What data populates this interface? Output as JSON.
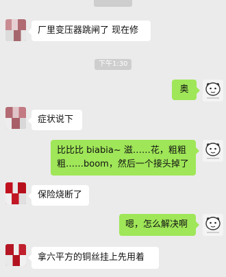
{
  "chat": {
    "top_time": "",
    "time_divider": "下午1:30",
    "messages": [
      {
        "side": "left",
        "text_lines": [
          "厂里变压器跳闸了 现在修"
        ]
      },
      {
        "side": "right",
        "text_lines": [
          "奥"
        ]
      },
      {
        "side": "left",
        "text_lines": [
          "症状说下"
        ]
      },
      {
        "side": "right",
        "text_lines": [
          "比比比 biabia~ 滋……花，粗粗",
          "粗……boom，然后一个接头掉了"
        ]
      },
      {
        "side": "left",
        "text_lines": [
          "保险烧断了"
        ]
      },
      {
        "side": "right",
        "text_lines": [
          "嗯，怎么解决啊"
        ]
      },
      {
        "side": "left",
        "text_lines": [
          "拿六平方的铜丝挂上先用着"
        ]
      }
    ]
  },
  "colors": {
    "background": "#ebebeb",
    "bubble_left": "#ffffff",
    "bubble_right": "#9fe658",
    "time_pill": "#cecece"
  },
  "icons": {
    "left_avatar": "pixelated-avatar-icon",
    "right_avatar": "cartoon-avatar-icon"
  }
}
